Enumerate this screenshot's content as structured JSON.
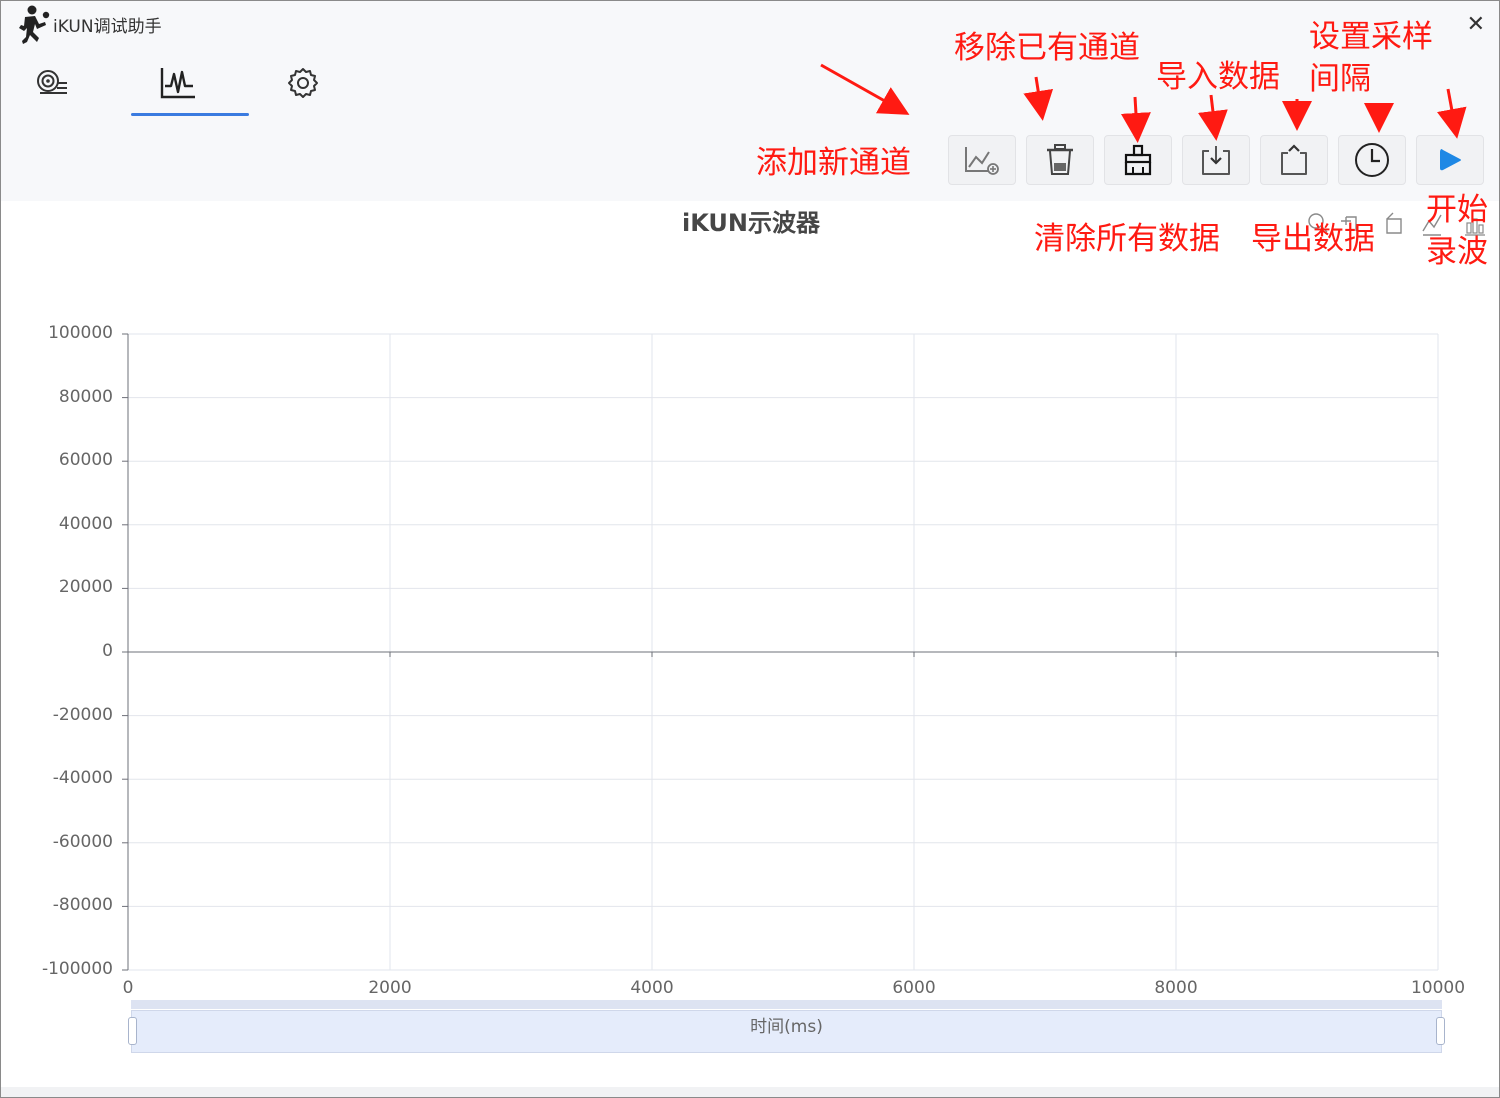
{
  "window": {
    "title": "iKUN调试助手",
    "close_glyph": "✕"
  },
  "nav": {
    "tabs": [
      {
        "icon": "serial-port-icon"
      },
      {
        "icon": "waveform-icon",
        "active": true
      },
      {
        "icon": "settings-gear-icon"
      }
    ]
  },
  "toolbar": {
    "buttons": [
      {
        "name": "add-channel-button",
        "icon": "chart-add-icon"
      },
      {
        "name": "remove-channel-button",
        "icon": "trash-icon"
      },
      {
        "name": "clear-data-button",
        "icon": "broom-icon"
      },
      {
        "name": "import-data-button",
        "icon": "import-icon"
      },
      {
        "name": "export-data-button",
        "icon": "export-icon"
      },
      {
        "name": "sample-interval-button",
        "icon": "clock-icon"
      },
      {
        "name": "start-recording-button",
        "icon": "play-icon",
        "color": "#1e88e5"
      }
    ]
  },
  "annotations": {
    "add_channel": "添加新通道",
    "remove_channel": "移除已有通道",
    "clear_data": "清除所有数据",
    "import_data": "导入数据",
    "export_data": "导出数据",
    "sample_interval_line1": "设置采样",
    "sample_interval_line2": "间隔",
    "start_line1": "开始",
    "start_line2": "录波",
    "color": "#ff1a12"
  },
  "chart_data": {
    "type": "line",
    "title": "iKUN示波器",
    "xlabel": "时间(ms)",
    "ylabel": "",
    "xlim": [
      0,
      10000
    ],
    "ylim": [
      -100000,
      100000
    ],
    "x_ticks": [
      "0",
      "2000",
      "4000",
      "6000",
      "8000",
      "10000"
    ],
    "y_ticks": [
      "100000",
      "80000",
      "60000",
      "40000",
      "20000",
      "0",
      "-20000",
      "-40000",
      "-60000",
      "-80000",
      "-100000"
    ],
    "series": [],
    "grid": true,
    "toolbox": [
      "data-zoom-icon",
      "zoom-reset-icon",
      "restore-icon",
      "line-type-icon",
      "bar-type-icon"
    ],
    "datazoom": {
      "start": 0,
      "end": 100
    }
  }
}
